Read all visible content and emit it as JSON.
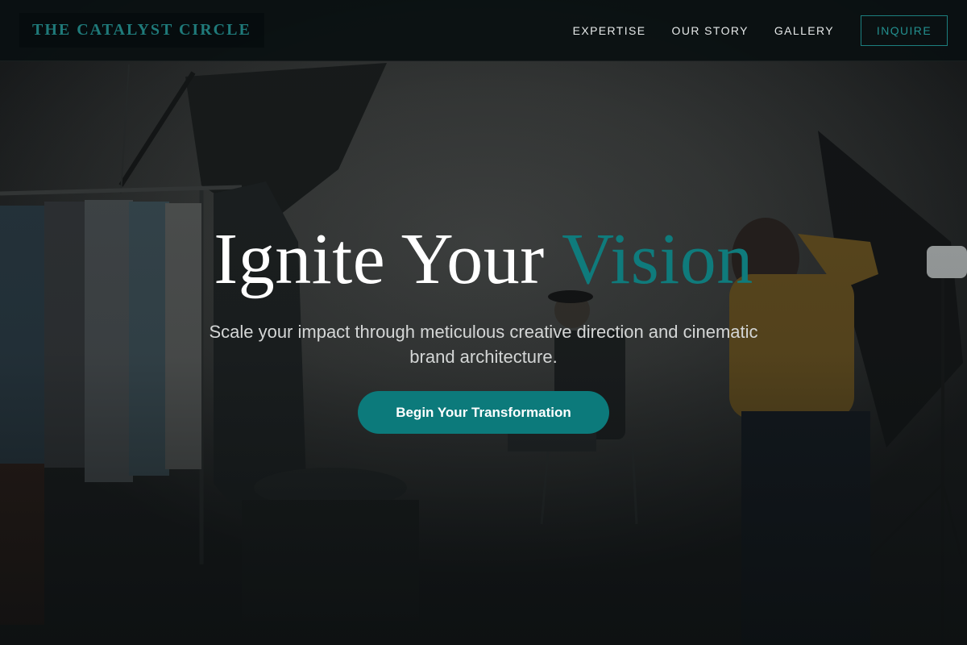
{
  "brand": {
    "name": "THE CATALYST CIRCLE",
    "accent_color": "#0f7b7c"
  },
  "nav": {
    "items": [
      {
        "label": "EXPERTISE"
      },
      {
        "label": "OUR STORY"
      },
      {
        "label": "GALLERY"
      }
    ],
    "inquire_label": "INQUIRE"
  },
  "hero": {
    "title_main": "Ignite Your",
    "title_accent": "Vision",
    "subtitle": "Scale your impact through meticulous creative direction and cinematic brand architecture.",
    "cta_label": "Begin Your Transformation",
    "background_image": "photo-studio-shoot"
  }
}
